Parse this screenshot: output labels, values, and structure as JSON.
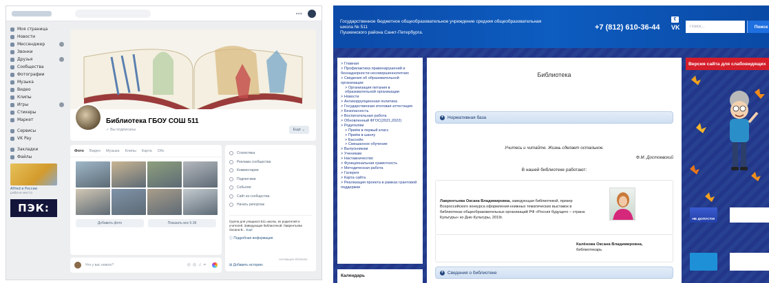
{
  "vk": {
    "nav": [
      "Моя страница",
      "Новости",
      "Мессенджер",
      "Звонки",
      "Друзья",
      "Сообщества",
      "Фотографии",
      "Музыка",
      "Видео",
      "Клипы",
      "Игры",
      "Стикеры",
      "Маркет"
    ],
    "nav2": [
      "Сервисы",
      "VK Pay"
    ],
    "nav3": [
      "Закладки",
      "Файлы"
    ],
    "ad_title": "Alfred в России",
    "ad_sub": "рабоче место",
    "pek_logo": "ПЭК:",
    "group_title": "Библиотека ГБОУ СОШ 511",
    "subscribed": "Вы подписаны",
    "more_btn": "Ещё",
    "media_tabs": [
      "Фото",
      "Видео",
      "Музыка",
      "Клипы",
      "Карта",
      "Обс"
    ],
    "add_photo": "Добавить фото",
    "show_all": "Показать все 5.3К",
    "compose_placeholder": "Что у вас нового?",
    "right_menu": [
      "Статистика",
      "Реклама сообщества",
      "Комментарии",
      "Подписчики",
      "События",
      "Сайт из сообщества",
      "Начать репортаж"
    ],
    "desc": "Группа для учащихся 511 школы, их родителей и учителей. Заведующая библиотекой: Лаврентьева Оксана В...",
    "desc_more": "Ещё",
    "detail": "Подробная информация",
    "add_post": "Добавить историю",
    "activate": "Активация Windows"
  },
  "site": {
    "org_line1": "Государственное бюджетное общеобразовательное учреждение средняя общеобразовательная школа № 511",
    "org_line2": "Пушкинского района Санкт-Петербурга.",
    "phone": "+7 (812) 610-36-44",
    "rss": "ʕ",
    "vk": "VK",
    "search_placeholder": "Поиск...",
    "search_btn": "Поиск",
    "menu": [
      {
        "t": "Главная",
        "sub": false
      },
      {
        "t": "Профилактика правонарушений и безнадзорности несовершеннолетних",
        "sub": false
      },
      {
        "t": "Сведения об образовательной организации",
        "sub": false
      },
      {
        "t": "Организация питания в образовательной организации",
        "sub": true
      },
      {
        "t": "Новости",
        "sub": false
      },
      {
        "t": "Антикоррупционная политика",
        "sub": false
      },
      {
        "t": "Государственная итоговая аттестация",
        "sub": false
      },
      {
        "t": "Безопасность",
        "sub": false
      },
      {
        "t": "Воспитательная работа",
        "sub": false
      },
      {
        "t": "Обновленный ФГОС(2021,2022)",
        "sub": false
      },
      {
        "t": "Родителям",
        "sub": false
      },
      {
        "t": "Приём в первый класс",
        "sub": true
      },
      {
        "t": "Приём в школу",
        "sub": true
      },
      {
        "t": "Бассейн",
        "sub": true
      },
      {
        "t": "Смешанное обучение",
        "sub": true
      },
      {
        "t": "Выпускникам",
        "sub": false
      },
      {
        "t": "Ученикам",
        "sub": false
      },
      {
        "t": "Наставничество",
        "sub": false
      },
      {
        "t": "Функциональная грамотность",
        "sub": false
      },
      {
        "t": "Методическая работа",
        "sub": false
      },
      {
        "t": "Галерея",
        "sub": false
      },
      {
        "t": "Карта сайта",
        "sub": false
      },
      {
        "t": "Реализация проекта в рамках грантовой поддержки",
        "sub": false
      }
    ],
    "calendar": "Календарь",
    "title": "Библиотека",
    "section1": "Нормативная база",
    "quote": "Учитесь и читайте. Жизнь сделает остальное.",
    "quote_author": "Ф.М. Достоевский",
    "work_heading": "В нашей библиотеке работают:",
    "person1_name": "Лаврентьева Оксана Владимировна,",
    "person1_text": " заведующая библиотекой, призер Всероссийского конкурса оформления книжных тематических выставок в библиотеках общеобразовательных организаций РФ «Россия будущего – страна Культуры» ко Дню Культуры, 2019г.",
    "person2_name": "Калёнова Оксана Владимировна,",
    "person2_text": " библиотекарь",
    "section2": "Сведения о библиотеке",
    "vision": "Версия сайта для слабовидящих",
    "banner1": "НЕ ДОПУСТИ!"
  },
  "colors": {
    "site_header": "#0b4aa8",
    "site_bg": "#253a8f",
    "vision_red": "#d51e2a",
    "link_blue": "#1d3b8f"
  }
}
